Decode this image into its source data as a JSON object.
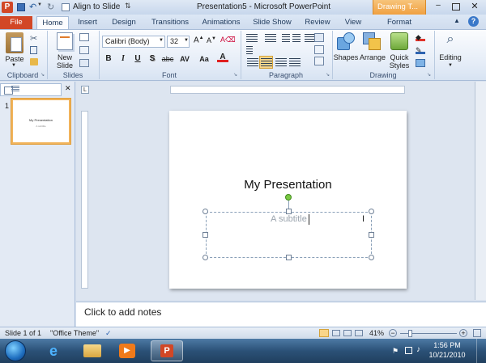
{
  "window": {
    "title": "Presentation5 - Microsoft PowerPoint",
    "contextual_tab_group": "Drawing T...",
    "qat_align": "Align to Slide"
  },
  "ribbon_tabs": [
    "File",
    "Home",
    "Insert",
    "Design",
    "Transitions",
    "Animations",
    "Slide Show",
    "Review",
    "View",
    "Format"
  ],
  "active_tab": "Home",
  "ribbon": {
    "clipboard": {
      "paste": "Paste",
      "label": "Clipboard"
    },
    "slides": {
      "new_slide_line1": "New",
      "new_slide_line2": "Slide",
      "label": "Slides"
    },
    "font": {
      "font_name": "Calibri (Body)",
      "font_size": "32",
      "label": "Font",
      "bold": "B",
      "italic": "I",
      "underline": "U",
      "shadow": "S",
      "strike": "abc",
      "spacing": "AV",
      "case": "Aa",
      "color": "A"
    },
    "paragraph": {
      "label": "Paragraph"
    },
    "drawing": {
      "shapes": "Shapes",
      "arrange": "Arrange",
      "quick_styles_line1": "Quick",
      "quick_styles_line2": "Styles",
      "label": "Drawing"
    },
    "editing": {
      "label": "Editing"
    }
  },
  "thumbnails": [
    {
      "number": "1",
      "title": "My Presentation",
      "subtitle": "A subtitle"
    }
  ],
  "slide": {
    "title": "My Presentation",
    "subtitle": "A subtitle"
  },
  "notes_placeholder": "Click to add notes",
  "status": {
    "slide_counter": "Slide 1 of 1",
    "theme": "\"Office Theme\"",
    "zoom": "41%"
  },
  "taskbar": {
    "time": "1:56 PM",
    "date": "10/21/2010"
  },
  "colors": {
    "file_tab": "#d24726",
    "contextual_tab": "#f5b05a",
    "ribbon_accent": "#1e395b",
    "selection_dash": "#8aa0b8"
  }
}
